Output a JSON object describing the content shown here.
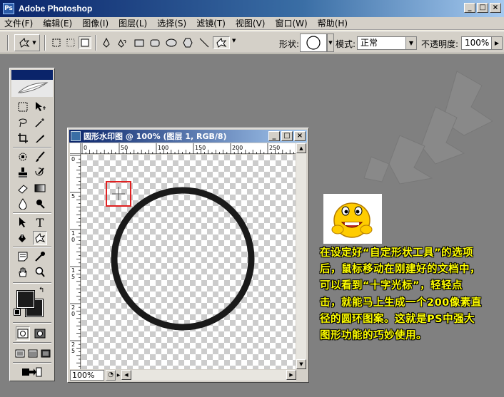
{
  "app": {
    "title": "Adobe Photoshop"
  },
  "window_controls": {
    "minimize": "_",
    "maximize": "□",
    "close": "×"
  },
  "menu": [
    "文件(F)",
    "编辑(E)",
    "图像(I)",
    "图层(L)",
    "选择(S)",
    "滤镜(T)",
    "视图(V)",
    "窗口(W)",
    "帮助(H)"
  ],
  "options": {
    "shape_label": "形状:",
    "mode_label": "模式:",
    "mode_value": "正常",
    "opacity_label": "不透明度:",
    "opacity_value": "100%",
    "opacity_arrow": "▶",
    "select_arrow": "▼"
  },
  "document": {
    "title": "圆形水印图 @ 100% (图层 1, RGB/8)",
    "zoom": "100%",
    "ruler_h_labels": [
      "0",
      "50",
      "100",
      "150",
      "200",
      "250"
    ],
    "ruler_v_labels": [
      "0",
      "5",
      "1\n0",
      "1\n5",
      "2\n0",
      "2\n5"
    ],
    "circle_stroke_color": "#1a1a1a",
    "cursor_box_color": "#e02020"
  },
  "toolbox": {
    "fg_color": "#1b1b1b",
    "bg_color": "#1b1b1b",
    "tools": [
      "marquee-icon",
      "move-icon",
      "lasso-icon",
      "magic-wand-icon",
      "crop-icon",
      "slice-icon",
      "healing-brush-icon",
      "brush-icon",
      "clone-stamp-icon",
      "history-brush-icon",
      "eraser-icon",
      "gradient-icon",
      "blur-icon",
      "dodge-icon",
      "path-select-icon",
      "type-icon",
      "pen-icon",
      "custom-shape-icon",
      "notes-icon",
      "eyedropper-icon",
      "hand-icon",
      "zoom-icon"
    ]
  },
  "annotation": {
    "text": "在设定好“自定形状工具”的选项后，鼠标移动在刚建好的文档中，可以看到“十字光标”，轻轻点击，就能马上生成一个200像素直径的圆环图案。这就是PS中强大图形功能的巧妙使用。",
    "color": "#ffff00"
  }
}
